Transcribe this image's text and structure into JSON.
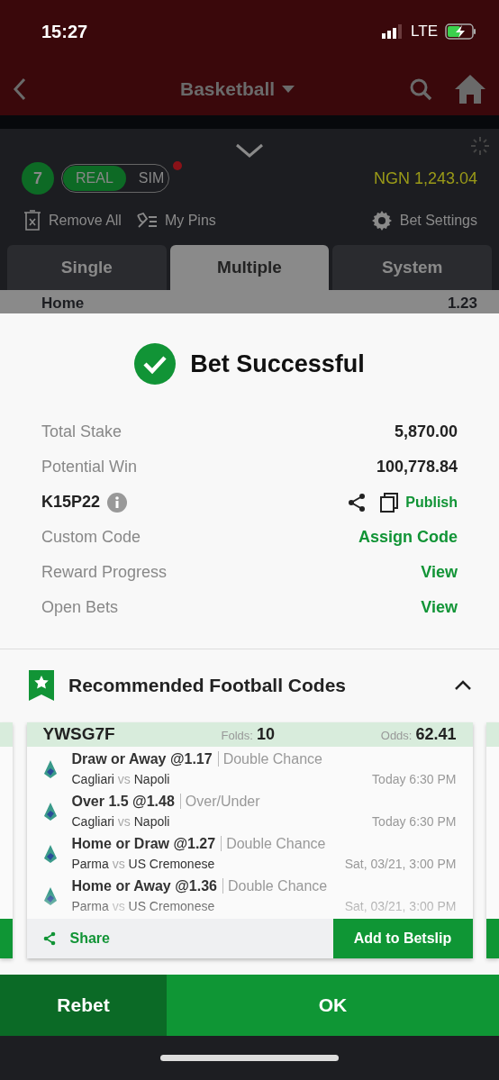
{
  "status_bar": {
    "time": "15:27",
    "network": "LTE"
  },
  "header": {
    "title": "Basketball"
  },
  "betslip": {
    "count": "7",
    "modes": [
      {
        "label": "REAL",
        "selected": true
      },
      {
        "label": "SIM",
        "selected": false
      }
    ],
    "balance": "NGN 1,243.04",
    "tools": [
      {
        "kind": "remove",
        "label": "Remove All"
      },
      {
        "kind": "pins",
        "label": "My Pins"
      },
      {
        "kind": "settings",
        "label": "Bet Settings"
      }
    ],
    "tabs": [
      {
        "label": "Single",
        "selected": false
      },
      {
        "label": "Multiple",
        "selected": true
      },
      {
        "label": "System",
        "selected": false
      }
    ],
    "peek": {
      "selection": "Home",
      "odds": "1.23"
    }
  },
  "dialog": {
    "title": "Bet Successful",
    "rows": [
      {
        "kind": "text",
        "label": "Total Stake",
        "value": "5,870.00"
      },
      {
        "kind": "text",
        "label": "Potential Win",
        "value": "100,778.84"
      },
      {
        "kind": "code",
        "label": "K15P22",
        "value": "Publish"
      },
      {
        "kind": "link",
        "label": "Custom Code",
        "value": "Assign Code"
      },
      {
        "kind": "link",
        "label": "Reward Progress",
        "value": "View"
      },
      {
        "kind": "link",
        "label": "Open Bets",
        "value": "View"
      }
    ]
  },
  "recommendations": {
    "title": "Recommended Football Codes",
    "expanded": true,
    "cards": [
      {
        "code": "YWSG7F",
        "folds_label": "Folds:",
        "folds": "10",
        "odds_label": "Odds:",
        "odds": "62.41",
        "selections": [
          {
            "pick": "Draw or Away @1.17",
            "market": "Double Chance",
            "home": "Cagliari",
            "vs": "vs",
            "away": "Napoli",
            "time": "Today 6:30 PM"
          },
          {
            "pick": "Over 1.5 @1.48",
            "market": "Over/Under",
            "home": "Cagliari",
            "vs": "vs",
            "away": "Napoli",
            "time": "Today 6:30 PM"
          },
          {
            "pick": "Home or Draw @1.27",
            "market": "Double Chance",
            "home": "Parma",
            "vs": "vs",
            "away": "US Cremonese",
            "time": "Sat, 03/21, 3:00 PM"
          },
          {
            "pick": "Home or Away @1.36",
            "market": "Double Chance",
            "home": "Parma",
            "vs": "vs",
            "away": "US Cremonese",
            "time": "Sat, 03/21, 3:00 PM"
          }
        ],
        "share": "Share",
        "add": "Add to Betslip"
      }
    ]
  },
  "actions": [
    {
      "kind": "secondary",
      "label": "Rebet"
    },
    {
      "kind": "primary",
      "label": "OK"
    }
  ]
}
